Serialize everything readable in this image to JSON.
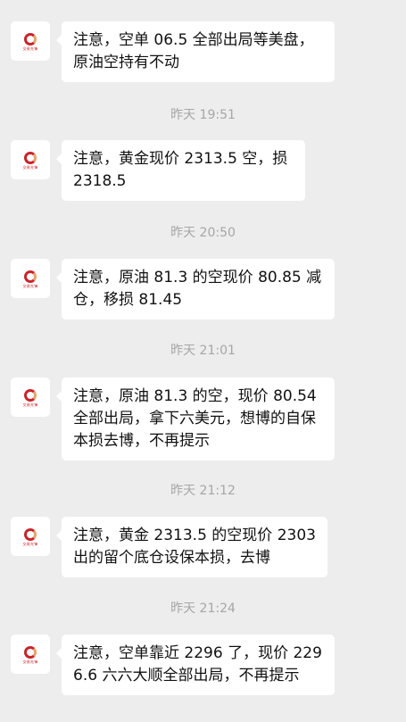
{
  "avatar": {
    "icon": "company-logo-icon",
    "text": "交易先锋"
  },
  "messages": [
    {
      "text": "注意，空单 06.5 全部出局等美盘，原油空持有不动"
    },
    {
      "text": "注意，黄金现价 2313.5 空，损 2318.5"
    },
    {
      "text": "注意，原油 81.3 的空现价 80.85 减仓，移损 81.45"
    },
    {
      "text": "注意，原油 81.3 的空，现价 80.54 全部出局，拿下六美元，想博的自保本损去博，不再提示"
    },
    {
      "text": "注意，黄金 2313.5 的空现价 2303 出的留个底仓设保本损，去博"
    },
    {
      "text": "注意，空单靠近 2296 了，现价 2296.6 六六大顺全部出局，不再提示"
    }
  ],
  "timestamps": [
    "昨天 19:51",
    "昨天 20:50",
    "昨天 21:01",
    "昨天 21:12",
    "昨天 21:24"
  ],
  "colors": {
    "background": "#ededed",
    "bubble": "#ffffff",
    "logo_red": "#c8242a",
    "timestamp": "#a6a6a6"
  }
}
